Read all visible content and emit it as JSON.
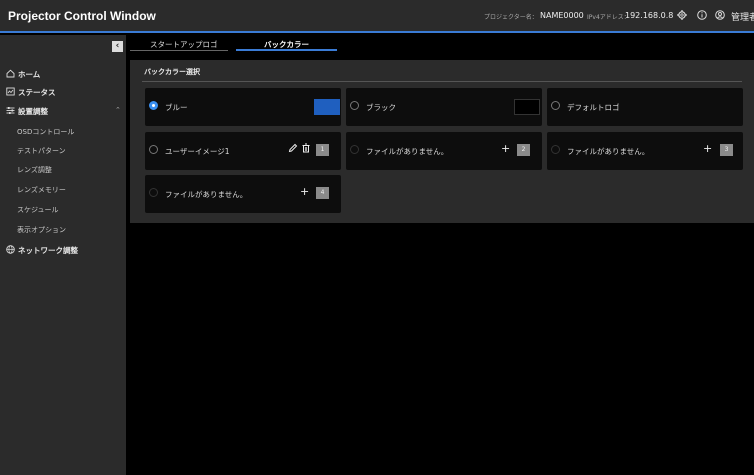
{
  "header": {
    "title": "Projector Control Window",
    "projector_name_label": "プロジェクター名：",
    "projector_name": "NAME0000",
    "ip_label": "IPv4アドレス：",
    "ip_address": "192.168.0.8",
    "user": "管理者",
    "accent_color": "#3a7bd5"
  },
  "sidebar": {
    "collapse_icon": "chevron-left-icon",
    "items": [
      {
        "label": "ホーム",
        "icon": "home-icon"
      },
      {
        "label": "ステータス",
        "icon": "status-icon"
      },
      {
        "label": "設置調整",
        "icon": "sliders-icon",
        "expanded": true,
        "children": [
          "OSDコントロール",
          "テストパターン",
          "レンズ調整",
          "レンズメモリー",
          "スケジュール",
          "表示オプション"
        ]
      },
      {
        "label": "ネットワーク調整",
        "icon": "globe-icon"
      }
    ]
  },
  "tabs": [
    {
      "label": "スタートアップロゴ",
      "active": false
    },
    {
      "label": "バックカラー",
      "active": true
    }
  ],
  "panel": {
    "title": "バックカラー選択",
    "options": [
      {
        "label": "ブルー",
        "selected": true,
        "swatch": "#1f5fbf"
      },
      {
        "label": "ブラック",
        "selected": false,
        "swatch": "#000000"
      },
      {
        "label": "デフォルトロゴ",
        "selected": false
      },
      {
        "label": "ユーザーイメージ1",
        "selected": false,
        "slot": "1"
      },
      {
        "label": "ファイルがありません。",
        "selected": false,
        "slot": "2"
      },
      {
        "label": "ファイルがありません。",
        "selected": false,
        "slot": "3"
      },
      {
        "label": "ファイルがありません。",
        "selected": false,
        "slot": "4"
      }
    ],
    "add_symbol": "+"
  }
}
